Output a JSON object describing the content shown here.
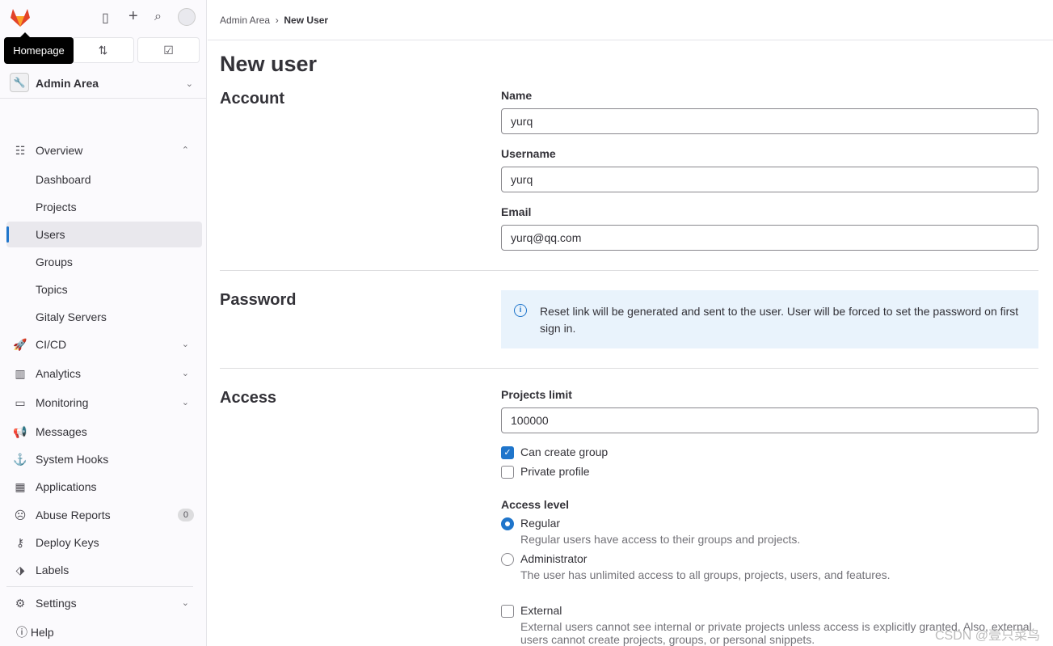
{
  "sidebar": {
    "tooltip": "Homepage",
    "context": "Admin Area",
    "items": [
      {
        "label": "Overview",
        "icon": "overview-icon"
      },
      {
        "label": "Dashboard"
      },
      {
        "label": "Projects"
      },
      {
        "label": "Users"
      },
      {
        "label": "Groups"
      },
      {
        "label": "Topics"
      },
      {
        "label": "Gitaly Servers"
      },
      {
        "label": "CI/CD",
        "icon": "rocket-icon"
      },
      {
        "label": "Analytics",
        "icon": "chart-icon"
      },
      {
        "label": "Monitoring",
        "icon": "monitor-icon"
      },
      {
        "label": "Messages",
        "icon": "bullhorn-icon"
      },
      {
        "label": "System Hooks",
        "icon": "anchor-icon"
      },
      {
        "label": "Applications",
        "icon": "applications-icon"
      },
      {
        "label": "Abuse Reports",
        "icon": "abuse-icon",
        "badge": "0"
      },
      {
        "label": "Deploy Keys",
        "icon": "key-icon"
      },
      {
        "label": "Labels",
        "icon": "label-icon"
      },
      {
        "label": "Settings",
        "icon": "settings-icon"
      }
    ],
    "help": "Help"
  },
  "breadcrumb": {
    "parent": "Admin Area",
    "current": "New User"
  },
  "page": {
    "title": "New user",
    "account": {
      "heading": "Account",
      "name_label": "Name",
      "name": "yurq",
      "username_label": "Username",
      "username": "yurq",
      "email_label": "Email",
      "email": "yurq@qq.com"
    },
    "password": {
      "heading": "Password",
      "alert": "Reset link will be generated and sent to the user. User will be forced to set the password on first sign in."
    },
    "access": {
      "heading": "Access",
      "projects_limit_label": "Projects limit",
      "projects_limit": "100000",
      "can_create_group": "Can create group",
      "can_create_group_checked": true,
      "private_profile": "Private profile",
      "private_profile_checked": false,
      "access_level_label": "Access level",
      "regular": "Regular",
      "regular_help": "Regular users have access to their groups and projects.",
      "admin": "Administrator",
      "admin_help": "The user has unlimited access to all groups, projects, users, and features.",
      "selected": "Regular",
      "external": "External",
      "external_help": "External users cannot see internal or private projects unless access is explicitly granted. Also, external users cannot create projects, groups, or personal snippets."
    }
  },
  "watermark": "CSDN @壹只菜鸟",
  "colors": {
    "accent": "#1f75cb",
    "alert_bg": "#e9f3fc"
  }
}
